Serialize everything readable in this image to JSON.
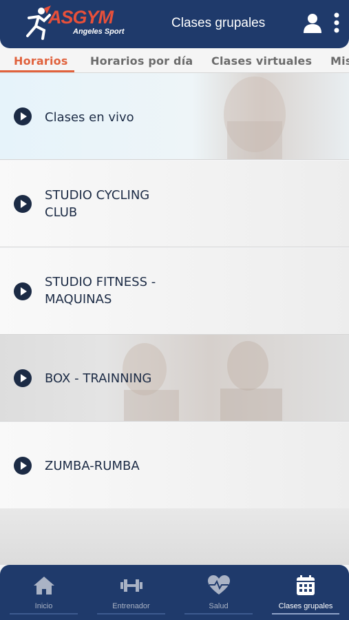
{
  "header": {
    "logo_text": "ASGYM",
    "logo_subtext": "Angeles Sport",
    "title": "Clases grupales",
    "user_icon": "user-icon",
    "menu_icon": "more-vertical-icon"
  },
  "tabs": [
    {
      "label": "Horarios",
      "active": true
    },
    {
      "label": "Horarios por día",
      "active": false
    },
    {
      "label": "Clases virtuales",
      "active": false
    },
    {
      "label": "Mis",
      "active": false
    }
  ],
  "classes": [
    {
      "label": "Clases en vivo",
      "icon": "play-icon"
    },
    {
      "label": "STUDIO CYCLING CLUB",
      "icon": "play-icon"
    },
    {
      "label": "STUDIO FITNESS - MAQUINAS",
      "icon": "play-icon"
    },
    {
      "label": "BOX - TRAINNING",
      "icon": "play-icon"
    },
    {
      "label": "ZUMBA-RUMBA",
      "icon": "play-icon"
    }
  ],
  "bottom_nav": [
    {
      "label": "Inicio",
      "icon": "home-icon",
      "active": false
    },
    {
      "label": "Entrenador",
      "icon": "dumbbell-icon",
      "active": false
    },
    {
      "label": "Salud",
      "icon": "heart-pulse-icon",
      "active": false
    },
    {
      "label": "Clases grupales",
      "icon": "calendar-icon",
      "active": true
    }
  ],
  "colors": {
    "primary": "#1f3a6b",
    "accent": "#e0623d",
    "text": "#1c2b45"
  }
}
